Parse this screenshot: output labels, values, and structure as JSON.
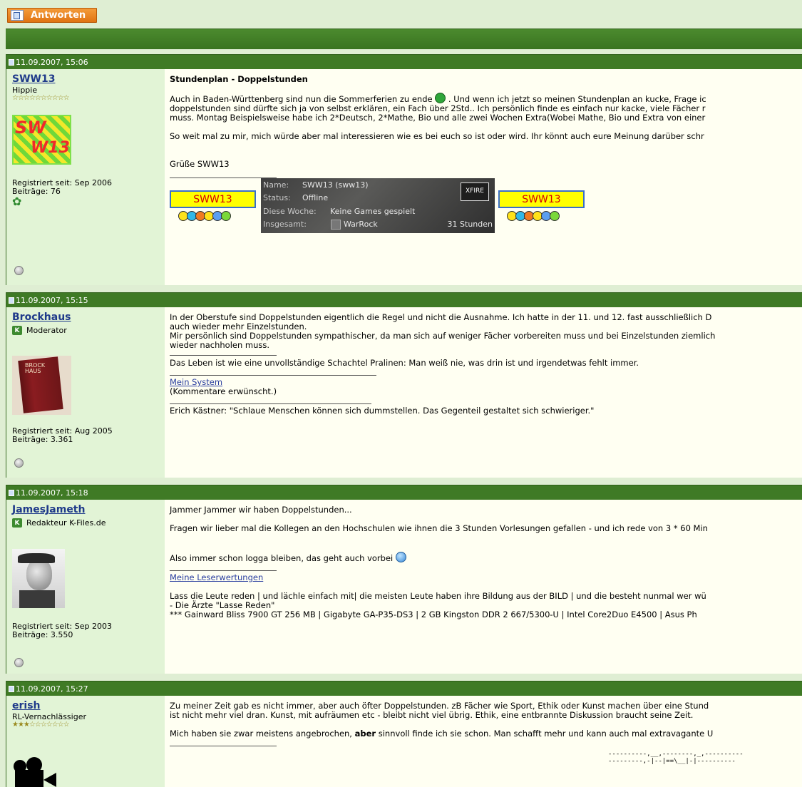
{
  "toolbar": {
    "reply_label": "Antworten"
  },
  "posts": [
    {
      "date": "11.09.2007, 15:06",
      "username": "SWW13",
      "rank": "Hippie",
      "stars": "☆☆☆☆☆☆☆☆☆☆",
      "avatar_text_1": "SW",
      "avatar_text_2": "W13",
      "registered": "Registriert seit: Sep 2006",
      "posts_count": "Beiträge: 76",
      "title": "Stundenplan - Doppelstunden",
      "lines": [
        "Auch in Baden-Württenberg sind nun die Sommerferien zu ende",
        ". Und wenn ich jetzt so meinen Stundenplan an kucke, Frage ic",
        "doppelstunden sind dürfte sich ja von selbst erklären, ein Fach über 2Std.. Ich persönlich finde es einfach nur kacke, viele Fächer r",
        "muss. Montag Beispielsweise habe ich 2*Deutsch, 2*Mathe, Bio und alle zwei Wochen Extra(Wobei Mathe, Bio und Extra von einer",
        "So weit mal zu mir, mich würde aber mal interessieren wie es bei euch so ist oder wird. Ihr könnt auch eure Meinung darüber schr",
        "Grüße SWW13"
      ],
      "sig_box_label": "SWW13",
      "xfire": {
        "name_label": "Name:",
        "name_value": "SWW13 (sww13)",
        "status_label": "Status:",
        "status_value": "Offline",
        "week_label": "Diese Woche:",
        "week_value": "Keine Games gespielt",
        "total_label": "Insgesamt:",
        "total_game": "WarRock",
        "total_hours": "31 Stunden",
        "logo": "XFIRE"
      }
    },
    {
      "date": "11.09.2007, 15:15",
      "username": "Brockhaus",
      "rank": "Moderator",
      "avatar_text": "BROCK HAUS",
      "registered": "Registriert seit: Aug 2005",
      "posts_count": "Beiträge: 3.361",
      "lines": [
        "In der Oberstufe sind Doppelstunden eigentlich die Regel und nicht die Ausnahme. Ich hatte in der 11. und 12. fast ausschließlich D",
        "auch wieder mehr Einzelstunden.",
        "Mir persönlich sind Doppelstunden sympathischer, da man sich auf weniger Fächer vorbereiten muss und bei Einzelstunden ziemlich",
        "wieder nachholen muss."
      ],
      "sig1": "Das Leben ist wie eine unvollständige Schachtel Pralinen: Man weiß nie, was drin ist und irgendetwas fehlt immer.",
      "sig_link": "Mein System",
      "sig_link_note": "(Kommentare erwünscht.)",
      "sig2": "Erich Kästner: \"Schlaue Menschen können sich dummstellen. Das Gegenteil gestaltet sich schwieriger.\""
    },
    {
      "date": "11.09.2007, 15:18",
      "username": "JamesJameth",
      "rank": "Redakteur K-Files.de",
      "registered": "Registriert seit: Sep 2003",
      "posts_count": "Beiträge: 3.550",
      "lines": [
        "Jammer Jammer wir haben Doppelstunden...",
        "Fragen wir lieber mal die Kollegen an den Hochschulen wie ihnen die 3 Stunden Vorlesungen gefallen - und ich rede von 3 * 60 Min",
        "Also immer schon logga bleiben, das geht auch vorbei"
      ],
      "sig_link": "Meine Leserwertungen",
      "sig_lines": [
        "Lass die Leute reden | und lächle einfach mit| die meisten Leute haben ihre Bildung aus der BILD | und die besteht nunmal wer wü",
        "- Die Ärzte \"Lasse Reden\"",
        "*** Gainward Bliss 7900 GT 256 MB | Gigabyte GA-P35-DS3 | 2 GB Kingston DDR 2 667/5300-U | Intel Core2Duo E4500 | Asus Ph"
      ]
    },
    {
      "date": "11.09.2007, 15:27",
      "username": "erish",
      "rank": "RL-Vernachlässiger",
      "stars": "★★★☆☆☆☆☆☆☆",
      "lines": [
        "Zu meiner Zeit gab es nicht immer, aber auch öfter Doppelstunden. zB Fächer wie Sport, Ethik oder Kunst machen über eine Stund",
        "ist nicht mehr viel dran. Kunst, mit aufräumen etc - bleibt nicht viel übrig. Ethik, eine entbrannte Diskussion braucht seine Zeit."
      ],
      "line3_a": "Mich haben sie zwar meistens angebrochen,",
      "line3_bold": "aber",
      "line3_b": "sinnvoll finde ich sie schon. Man schafft mehr und kann auch mal extravagante U",
      "ascii_1": "----------,__,--------,_,----------",
      "ascii_2": "---------,-|--|==\\__|-|----------"
    }
  ]
}
